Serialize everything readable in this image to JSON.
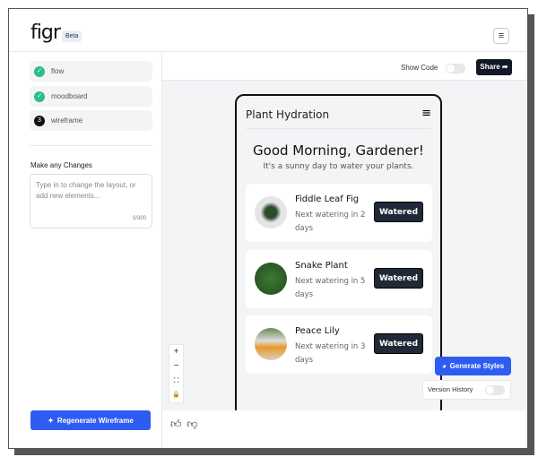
{
  "header": {
    "logo": "figr",
    "badge": "Beta",
    "menu_icon": "hamburger-icon"
  },
  "sidebar": {
    "steps": [
      {
        "label": "flow",
        "status": "done"
      },
      {
        "label": "moodboard",
        "status": "done"
      },
      {
        "label": "wireframe",
        "status": "current",
        "number": "3"
      }
    ],
    "changes_label": "Make any Changes",
    "changes_placeholder": "Type in to change the layout, or add new elements...",
    "char_count": "0/300",
    "regenerate_label": "Regenerate Wireframe"
  },
  "toolbar": {
    "show_code_label": "Show Code",
    "share_label": "Share"
  },
  "phone": {
    "title": "Plant Hydration",
    "greeting": "Good Morning, Gardener!",
    "subtitle": "It's a sunny day to water your plants.",
    "plants": [
      {
        "name": "Fiddle Leaf Fig",
        "next": "Next watering in 2 days",
        "button": "Watered"
      },
      {
        "name": "Snake Plant",
        "next": "Next watering in 5 days",
        "button": "Watered"
      },
      {
        "name": "Peace Lily",
        "next": "Next watering in 3 days",
        "button": "Watered"
      }
    ]
  },
  "canvas": {
    "generate_styles_label": "Generate Styles",
    "version_history_label": "Version History"
  }
}
